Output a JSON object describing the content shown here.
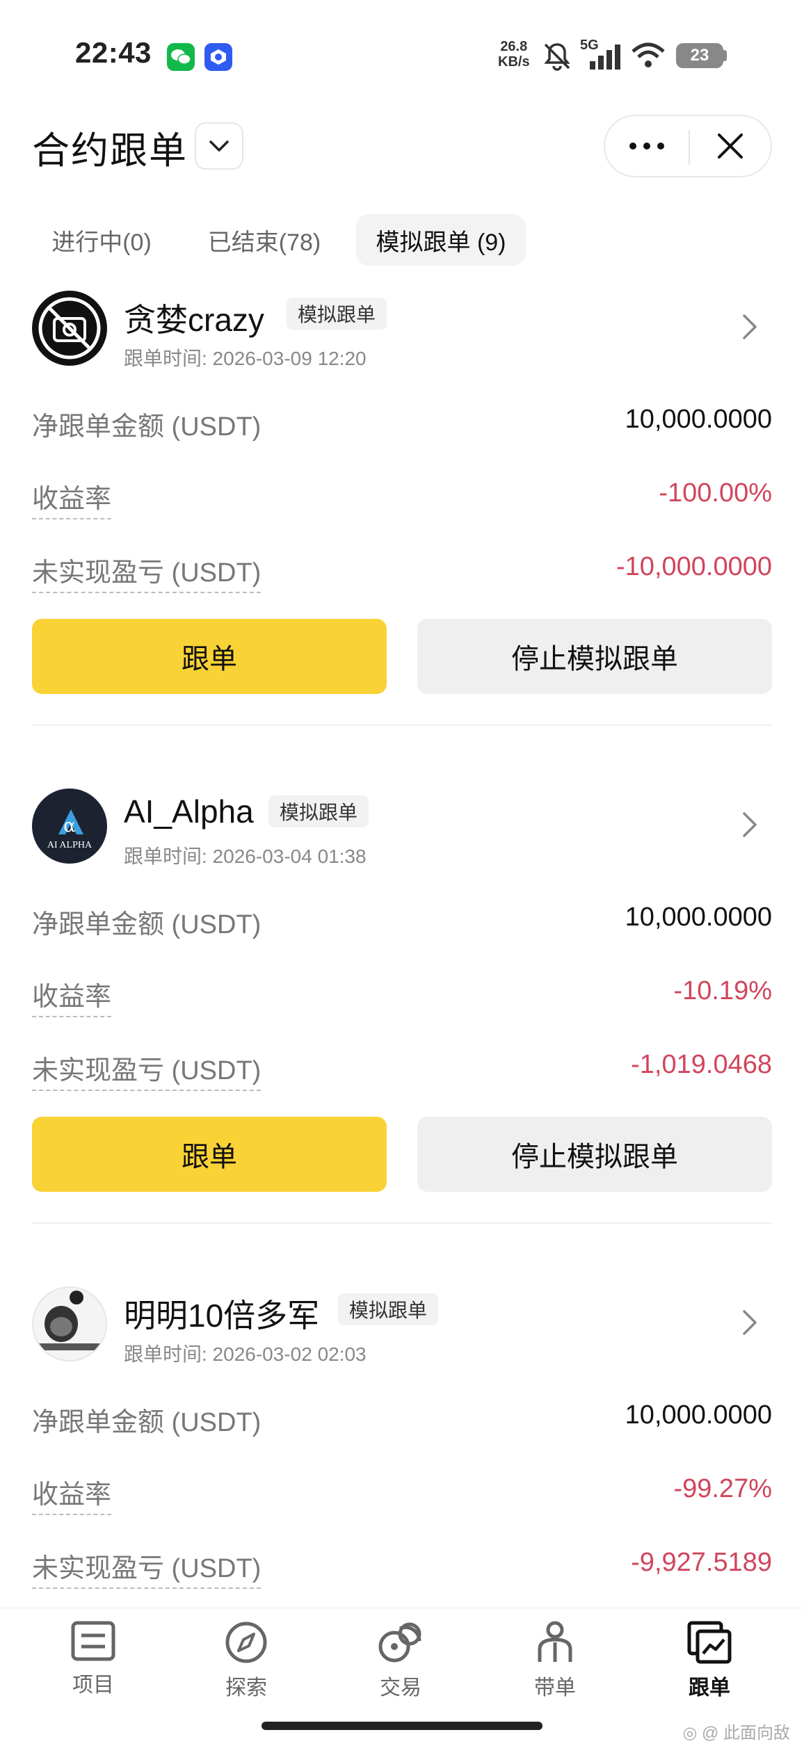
{
  "status_bar": {
    "time": "22:43",
    "net_speed_value": "26.8",
    "net_speed_unit": "KB/s",
    "network": "5G",
    "battery": "23"
  },
  "header": {
    "title": "合约跟单"
  },
  "tabs": [
    {
      "label": "进行中(0)"
    },
    {
      "label": "已结束(78)"
    },
    {
      "label": "模拟跟单 (9)"
    }
  ],
  "field_labels": {
    "net_amount": "净跟单金额 (USDT)",
    "yield": "收益率",
    "unrealized": "未实现盈亏 (USDT)"
  },
  "cards": [
    {
      "name": "贪婪crazy",
      "badge": "模拟跟单",
      "time": "跟单时间: 2026-03-09 12:20",
      "net_amount": "10,000.0000",
      "yield": "-100.00%",
      "unrealized": "-10,000.0000",
      "follow_label": "跟单",
      "stop_label": "停止模拟跟单"
    },
    {
      "name": "AI_Alpha",
      "badge": "模拟跟单",
      "time": "跟单时间: 2026-03-04 01:38",
      "net_amount": "10,000.0000",
      "yield": "-10.19%",
      "unrealized": "-1,019.0468",
      "follow_label": "跟单",
      "stop_label": "停止模拟跟单",
      "avatar_text": "AI ALPHA"
    },
    {
      "name": "明明10倍多军",
      "badge": "模拟跟单",
      "time": "跟单时间: 2026-03-02 02:03",
      "net_amount": "10,000.0000",
      "yield": "-99.27%",
      "unrealized": "-9,927.5189"
    }
  ],
  "bottom_nav": [
    {
      "label": "项目",
      "icon": "project-icon"
    },
    {
      "label": "探索",
      "icon": "compass-icon"
    },
    {
      "label": "交易",
      "icon": "trade-icon"
    },
    {
      "label": "带单",
      "icon": "lead-icon"
    },
    {
      "label": "跟单",
      "icon": "copy-trade-icon",
      "active": true
    }
  ],
  "watermark": "此面向敌",
  "colors": {
    "accent_yellow": "#f9d235",
    "loss_red": "#d1455b",
    "neutral_button": "#efefef"
  }
}
